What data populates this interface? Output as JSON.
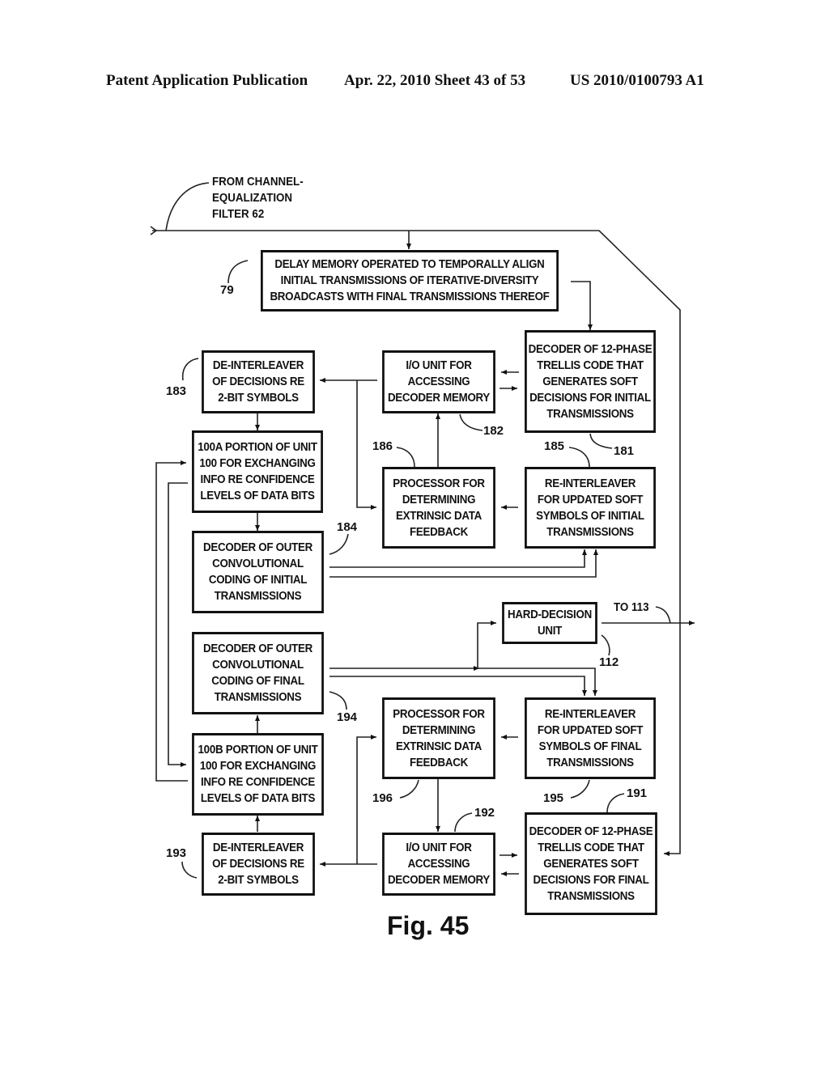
{
  "header": {
    "publication": "Patent Application Publication",
    "date_sheet": "Apr. 22, 2010  Sheet 43 of 53",
    "number": "US 2010/0100793 A1"
  },
  "figure": {
    "caption": "Fig. 45",
    "input_label": "FROM CHANNEL-\nEQUALIZATION\nFILTER 62",
    "output_label": "TO 113",
    "blocks": {
      "b79": {
        "ref": "79",
        "text": "DELAY MEMORY OPERATED TO TEMPORALLY ALIGN\nINITIAL TRANSMISSIONS OF ITERATIVE-DIVERSITY\nBROADCASTS WITH FINAL TRANSMISSIONS THEREOF"
      },
      "b181": {
        "ref": "181",
        "text": "DECODER OF 12-PHASE\nTRELLIS CODE THAT\nGENERATES SOFT\nDECISIONS FOR INITIAL\nTRANSMISSIONS"
      },
      "b182": {
        "ref": "182",
        "text": "I/O UNIT FOR\nACCESSING\nDECODER MEMORY"
      },
      "b183": {
        "ref": "183",
        "text": "DE-INTERLEAVER\nOF DECISIONS RE\n2-BIT SYMBOLS"
      },
      "b100a": {
        "text": "100A PORTION OF UNIT\n100 FOR EXCHANGING\nINFO RE CONFIDENCE\nLEVELS OF DATA BITS"
      },
      "b186": {
        "ref": "186",
        "text": "PROCESSOR FOR\nDETERMINING\nEXTRINSIC DATA\nFEEDBACK"
      },
      "b185": {
        "ref": "185",
        "text": "RE-INTERLEAVER\nFOR UPDATED SOFT\nSYMBOLS OF INITIAL\nTRANSMISSIONS"
      },
      "b184": {
        "ref": "184",
        "text": "DECODER OF OUTER\nCONVOLUTIONAL\nCODING OF INITIAL\nTRANSMISSIONS"
      },
      "b112": {
        "ref": "112",
        "text": "HARD-DECISION\nUNIT"
      },
      "b194": {
        "ref": "194",
        "text": "DECODER OF OUTER\nCONVOLUTIONAL\nCODING OF FINAL\nTRANSMISSIONS"
      },
      "b196": {
        "ref": "196",
        "text": "PROCESSOR FOR\nDETERMINING\nEXTRINSIC DATA\nFEEDBACK"
      },
      "b195": {
        "ref": "195",
        "text": "RE-INTERLEAVER\nFOR UPDATED SOFT\nSYMBOLS OF FINAL\nTRANSMISSIONS"
      },
      "b100b": {
        "text": "100B PORTION OF UNIT\n100 FOR EXCHANGING\nINFO RE CONFIDENCE\nLEVELS OF DATA BITS"
      },
      "b193": {
        "ref": "193",
        "text": "DE-INTERLEAVER\nOF DECISIONS RE\n2-BIT SYMBOLS"
      },
      "b192": {
        "ref": "192",
        "text": "I/O UNIT FOR\nACCESSING\nDECODER MEMORY"
      },
      "b191": {
        "ref": "191",
        "text": "DECODER OF 12-PHASE\nTRELLIS CODE THAT\nGENERATES SOFT\nDECISIONS FOR FINAL\nTRANSMISSIONS"
      }
    }
  }
}
